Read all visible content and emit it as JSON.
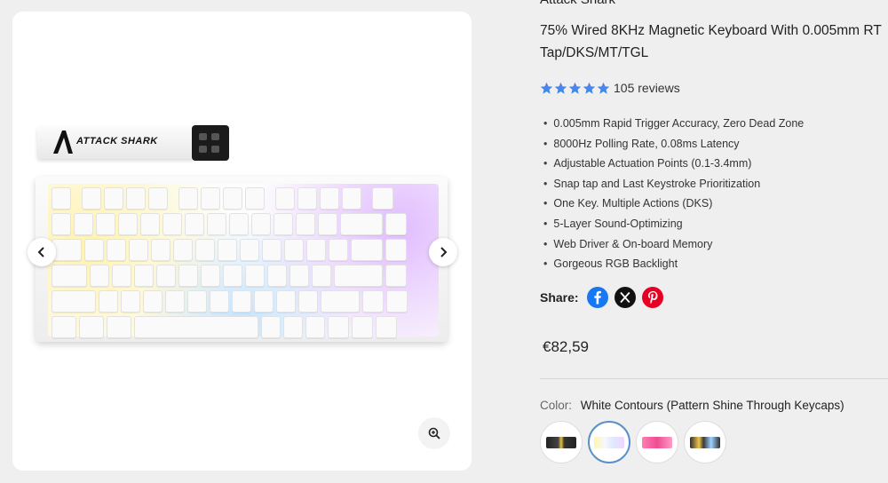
{
  "product": {
    "title_cut": "Attack Shark",
    "subtitle_line1": "75% Wired 8KHz Magnetic Keyboard With 0.005mm RT",
    "subtitle_line2": "Tap/DKS/MT/TGL",
    "rating": 5,
    "reviews_text": "105 reviews",
    "features": [
      "0.005mm Rapid Trigger Accuracy, Zero Dead Zone",
      "8000Hz Polling Rate, 0.08ms Latency",
      "Adjustable Actuation Points (0.1-3.4mm)",
      "Snap tap and Last Keystroke Prioritization",
      "One Key. Multiple Actions (DKS)",
      "5-Layer Sound-Optimizing",
      "Web Driver & On-board Memory",
      "Gorgeous RGB Backlight"
    ],
    "price": "€82,59"
  },
  "share": {
    "label": "Share:",
    "networks": [
      "facebook-icon",
      "x-icon",
      "pinterest-icon"
    ]
  },
  "color": {
    "label": "Color:",
    "value": "White Contours (Pattern Shine Through Keycaps)",
    "swatches": [
      {
        "name": "Black RGB",
        "color": "#2a2a2a"
      },
      {
        "name": "White Contours",
        "color": "#f4f4f8"
      },
      {
        "name": "Pink",
        "color": "#f06aa0"
      },
      {
        "name": "Retro Black",
        "color": "#3b3b3b"
      }
    ],
    "selected_index": 1
  },
  "gallery": {
    "image_brand_text": "ATTACK SHARK"
  },
  "colors": {
    "star": "#4a86e8",
    "facebook": "#1877f2",
    "x": "#111111",
    "pinterest": "#e60023",
    "selected_ring": "#5b8fc7"
  }
}
